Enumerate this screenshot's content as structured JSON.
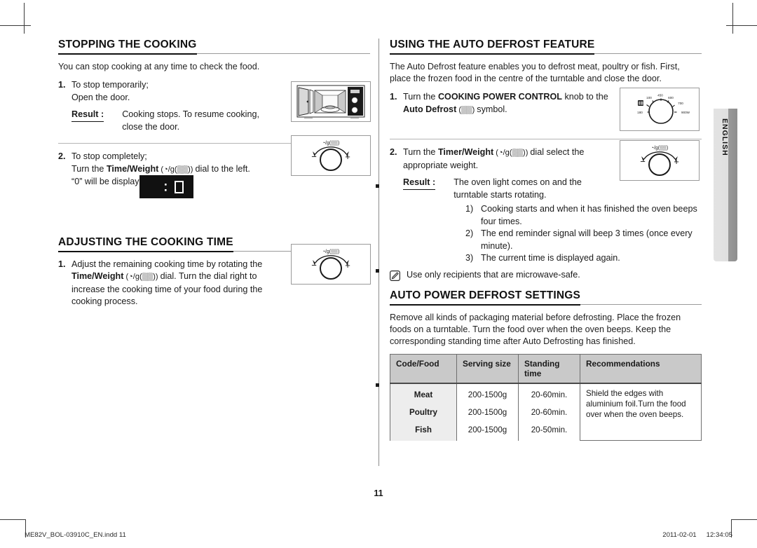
{
  "document": {
    "page_number": "11",
    "language_tab": "ENGLISH",
    "footer_file": "ME82V_BOL-03910C_EN.indd   11",
    "footer_date": "2011-02-01",
    "footer_time": "12:34:05"
  },
  "left_column": {
    "section1": {
      "heading": "STOPPING THE COOKING",
      "intro": "You can stop cooking at any time to check the food.",
      "step1": {
        "num": "1.",
        "line1": "To stop temporarily;",
        "line2": "Open the door.",
        "result_label": "Result :",
        "result_line1": "Cooking stops. To resume cooking,",
        "result_line2": "close the door."
      },
      "step2": {
        "num": "2.",
        "line1": "To stop completely;",
        "line2_pre": "Turn the ",
        "line2_bold": "Time/Weight",
        "line2_sym": " (◔/g(▒▒)) ",
        "line2_post": "dial to the left.",
        "line3": "“0” will be displayed."
      },
      "display_value": "0"
    },
    "section2": {
      "heading": "ADJUSTING THE COOKING TIME",
      "step1": {
        "num": "1.",
        "text_a": "Adjust the remaining cooking time by rotating the ",
        "text_bold": "Time/Weight",
        "text_sym": " (◔/g(▒▒)) ",
        "text_b": "dial. Turn the dial right to increase the cooking time of your food during the cooking process."
      }
    },
    "figures": {
      "oven": "microwave-oven-open-door",
      "dial_label": "◔/g(▒▒)",
      "dial_minus": "−",
      "dial_plus": "+"
    }
  },
  "right_column": {
    "section1": {
      "heading": "USING THE AUTO DEFROST FEATURE",
      "intro": "The Auto Defrost feature enables you to defrost meat, poultry or fish. First, place the frozen food in the centre of the turntable and close the door.",
      "step1": {
        "num": "1.",
        "text_a": "Turn the ",
        "bold1": "COOKING POWER CONTROL",
        "text_b": " knob to the ",
        "bold2": "Auto Defrost",
        "sym": " (▒▒) ",
        "text_c": "symbol."
      },
      "step2": {
        "num": "2.",
        "text_a": "Turn the ",
        "bold1": "Timer/Weight",
        "sym": " (◔/g(▒▒)) ",
        "text_b": "dial select the appropriate weight.",
        "result_label": "Result :",
        "result_line1": "The oven light comes on and the",
        "result_line2": "turntable starts rotating.",
        "sublist": [
          {
            "n": "1)",
            "t": "Cooking starts and when it has finished the oven beeps four times."
          },
          {
            "n": "2)",
            "t": "The end reminder signal will beep 3 times (once every minute)."
          },
          {
            "n": "3)",
            "t": "The current time is displayed again."
          }
        ]
      },
      "note": "Use only recipients that are microwave-safe."
    },
    "section2": {
      "heading": "AUTO POWER DEFROST SETTINGS",
      "intro": "Remove all kinds of packaging material before defrosting. Place the frozen foods on a turntable. Turn the food over when the oven beeps. Keep the corresponding standing time after Auto Defrosting has finished."
    },
    "table": {
      "headers": [
        "Code/Food",
        "Serving size",
        "Standing time",
        "Recommendations"
      ],
      "rows": [
        {
          "food": "Meat",
          "serving": "200-1500g",
          "standing": "20-60min."
        },
        {
          "food": "Poultry",
          "serving": "200-1500g",
          "standing": "20-60min."
        },
        {
          "food": "Fish",
          "serving": "200-1500g",
          "standing": "20-50min."
        }
      ],
      "recommendation": "Shield the edges with aluminium foil.Turn the food over when the oven beeps."
    },
    "figures": {
      "power_knob": "cooking-power-control-knob",
      "power_marks": [
        "100",
        "450",
        "600",
        "700",
        "900W",
        "180"
      ],
      "dial_label": "◔/g(▒▒)",
      "dial_minus": "−",
      "dial_plus": "+"
    }
  }
}
